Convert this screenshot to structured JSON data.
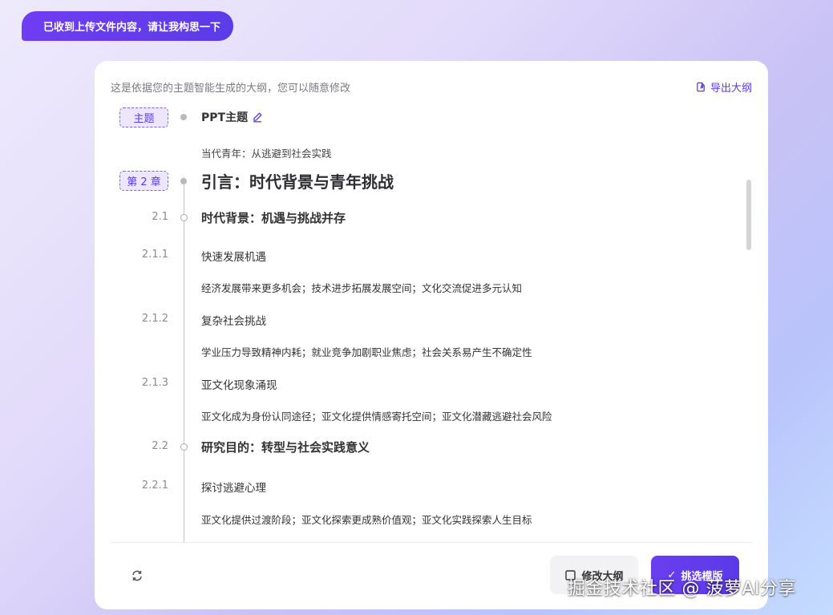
{
  "chat": {
    "message": "已收到上传文件内容，请让我构思一下"
  },
  "card": {
    "hint": "这是依据您的主题智能生成的大纲，您可以随意修改",
    "export_label": "导出大纲"
  },
  "outline": {
    "topic_tag": "主题",
    "topic_title": "PPT主题",
    "topic_value": "当代青年：从逃避到社会实践",
    "chapter_tag": "第 2 章",
    "chapter_title": "引言：时代背景与青年挑战",
    "items": [
      {
        "num": "2.1",
        "text": "时代背景：机遇与挑战并存"
      },
      {
        "num": "2.1.1",
        "text": "快速发展机遇"
      },
      {
        "num": "",
        "text": "经济发展带来更多机会；技术进步拓展发展空间；文化交流促进多元认知"
      },
      {
        "num": "2.1.2",
        "text": "复杂社会挑战"
      },
      {
        "num": "",
        "text": "学业压力导致精神内耗；就业竞争加剧职业焦虑；社会关系易产生不确定性"
      },
      {
        "num": "2.1.3",
        "text": "亚文化现象涌现"
      },
      {
        "num": "",
        "text": "亚文化成为身份认同途径；亚文化提供情感寄托空间；亚文化潜藏逃避社会风险"
      },
      {
        "num": "2.2",
        "text": "研究目的：转型与社会实践意义"
      },
      {
        "num": "2.2.1",
        "text": "探讨逃避心理"
      },
      {
        "num": "",
        "text": "亚文化提供过渡阶段；亚文化探索更成熟价值观；亚文化实践探索人生目标"
      }
    ]
  },
  "footer": {
    "edit_label": "修改大纲",
    "pick_label": "挑选模版"
  },
  "watermark": "掘金技术社区 @ 菠萝AI分享",
  "colors": {
    "accent": "#5b3be8",
    "tag_bg": "#ece7ff"
  }
}
